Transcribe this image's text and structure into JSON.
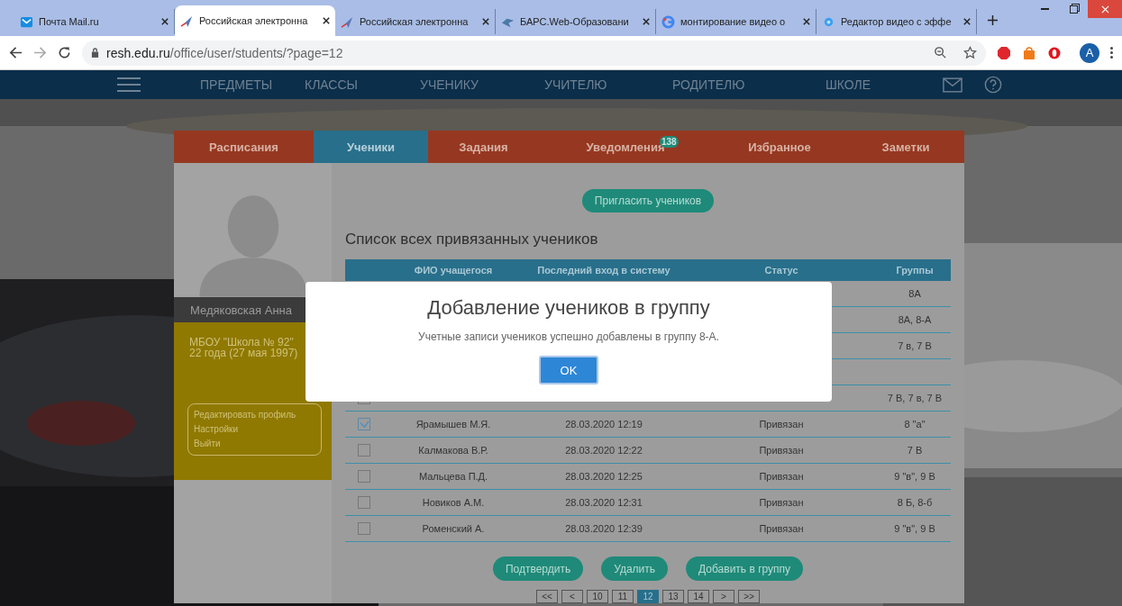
{
  "browser": {
    "tabs": [
      {
        "title": "Почта Mail.ru",
        "selected": false
      },
      {
        "title": "Российская электронна",
        "selected": true
      },
      {
        "title": "Российская электронна",
        "selected": false
      },
      {
        "title": "БАРС.Web-Образовани",
        "selected": false
      },
      {
        "title": "монтирование видео о",
        "selected": false
      },
      {
        "title": "Редактор видео с эффе",
        "selected": false
      }
    ],
    "url": {
      "host": "resh.edu.ru",
      "path": "/office/user/students/?page=12"
    },
    "profile_initial": "A"
  },
  "nav": [
    "ПРЕДМЕТЫ",
    "КЛАССЫ",
    "УЧЕНИКУ",
    "УЧИТЕЛЮ",
    "РОДИТЕЛЮ",
    "ШКОЛЕ"
  ],
  "site_tabs": [
    {
      "label": "Расписания",
      "selected": false
    },
    {
      "label": "Ученики",
      "selected": true
    },
    {
      "label": "Задания",
      "selected": false
    },
    {
      "label": "Уведомления",
      "selected": false,
      "badge": "138"
    },
    {
      "label": "Избранное",
      "selected": false
    },
    {
      "label": "Заметки",
      "selected": false
    }
  ],
  "profile": {
    "name": "Медяковская Анна",
    "school": "МБОУ \"Школа № 92\"",
    "age": "22 года (27 мая 1997)",
    "links": [
      "Редактировать профиль",
      "Настройки",
      "Выйти"
    ]
  },
  "invite_button": "Пригласить учеников",
  "list_title": "Список всех привязанных учеников",
  "table": {
    "columns": [
      "ФИО учащегося",
      "Последний вход в систему",
      "Статус",
      "Группы"
    ],
    "rows": [
      {
        "groups": "8А"
      },
      {
        "groups": "8А, 8-А"
      },
      {
        "groups": "7 в, 7 В"
      },
      {},
      {
        "checked": false,
        "groups": "7 В, 7 в, 7 В"
      },
      {
        "checked": true,
        "name": "Ярамышев М.Я.",
        "last_login": "28.03.2020 12:19",
        "status": "Привязан",
        "groups": "8 \"а\""
      },
      {
        "checked": false,
        "name": "Калмакова В.Р.",
        "last_login": "28.03.2020 12:22",
        "status": "Привязан",
        "groups": "7 В"
      },
      {
        "checked": false,
        "name": "Мальцева П.Д.",
        "last_login": "28.03.2020 12:25",
        "status": "Привязан",
        "groups": "9 \"в\", 9 В"
      },
      {
        "checked": false,
        "name": "Новиков А.М.",
        "last_login": "28.03.2020 12:31",
        "status": "Привязан",
        "groups": "8 Б, 8-б"
      },
      {
        "checked": false,
        "name": "Роменский А.",
        "last_login": "28.03.2020 12:39",
        "status": "Привязан",
        "groups": "9 \"в\", 9 В"
      }
    ]
  },
  "actions": [
    "Подтвердить",
    "Удалить",
    "Добавить в группу"
  ],
  "pagination": [
    {
      "label": "<<",
      "selected": false
    },
    {
      "label": "<",
      "selected": false
    },
    {
      "label": "10",
      "selected": false
    },
    {
      "label": "11",
      "selected": false
    },
    {
      "label": "12",
      "selected": true
    },
    {
      "label": "13",
      "selected": false
    },
    {
      "label": "14",
      "selected": false
    },
    {
      "label": ">",
      "selected": false
    },
    {
      "label": ">>",
      "selected": false
    }
  ],
  "modal": {
    "title": "Добавление учеников в группу",
    "message": "Учетные записи учеников успешно добавлены в группу 8-А.",
    "button": "OK"
  }
}
